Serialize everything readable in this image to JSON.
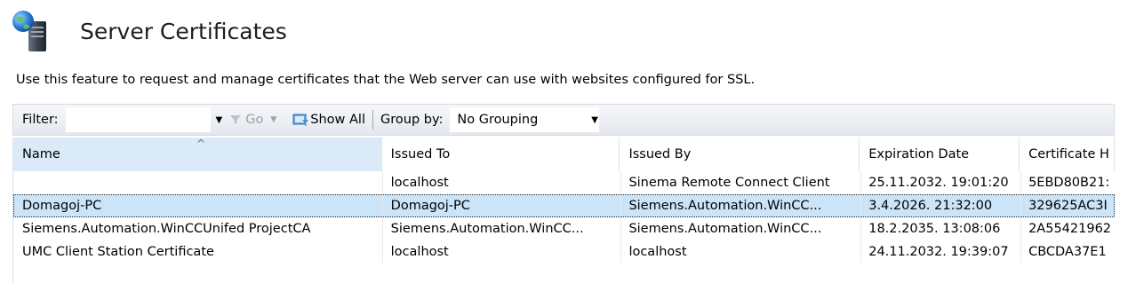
{
  "header": {
    "title": "Server Certificates",
    "icon": "server-certificates-icon"
  },
  "description": "Use this feature to request and manage certificates that the Web server can use with websites configured for SSL.",
  "toolbar": {
    "filter_label": "Filter:",
    "filter_value": "",
    "go_label": "Go",
    "show_all_label": "Show All",
    "group_by_label": "Group by:",
    "group_by_value": "No Grouping"
  },
  "table": {
    "columns": [
      "Name",
      "Issued To",
      "Issued By",
      "Expiration Date",
      "Certificate H"
    ],
    "sorted_column": "Name",
    "rows": [
      {
        "name": "",
        "issued_to": "localhost",
        "issued_by": "Sinema Remote Connect Client",
        "expiration": "25.11.2032. 19:01:20",
        "hash": "5EBD80B21:"
      },
      {
        "name": "Domagoj-PC",
        "issued_to": "Domagoj-PC",
        "issued_by": "Siemens.Automation.WinCC...",
        "expiration": "3.4.2026. 21:32:00",
        "hash": "329625AC3I"
      },
      {
        "name": "Siemens.Automation.WinCCUnifed ProjectCA",
        "issued_to": "Siemens.Automation.WinCC...",
        "issued_by": "Siemens.Automation.WinCC...",
        "expiration": "18.2.2035. 13:08:06",
        "hash": "2A55421962"
      },
      {
        "name": "UMC Client Station Certificate",
        "issued_to": "localhost",
        "issued_by": "localhost",
        "expiration": "24.11.2032. 19:39:07",
        "hash": "CBCDA37E1"
      }
    ],
    "selected_row_index": 1
  },
  "colors": {
    "selected_row": "#cbe4f8",
    "sorted_header": "#dbeaf8",
    "toolbar_bg": "#e8ecf1"
  }
}
